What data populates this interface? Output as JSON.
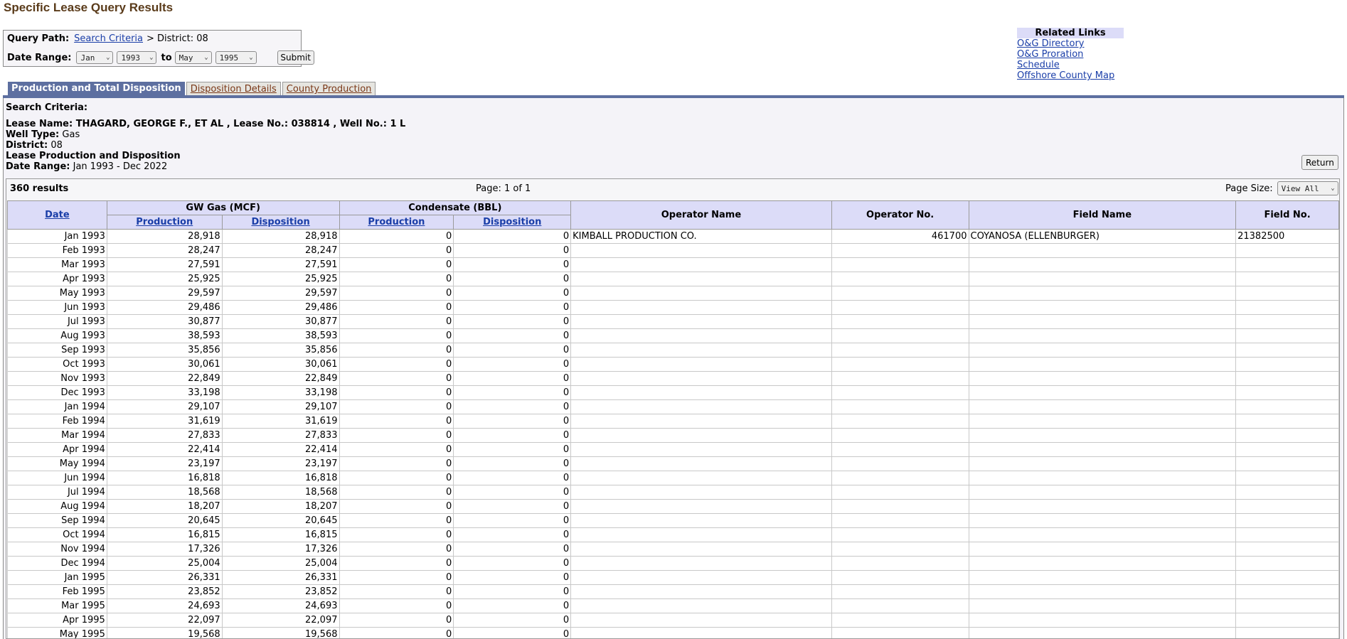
{
  "page_title": "Specific Lease Query Results",
  "query": {
    "path_label": "Query Path:",
    "path_link": "Search Criteria",
    "path_rest": "> District: 08",
    "range_label": "Date Range:",
    "from_month": "Jan",
    "from_year": "1993",
    "to_label": "to",
    "to_month": "May",
    "to_year": "1995",
    "submit_label": "Submit"
  },
  "related_links": {
    "heading": "Related Links",
    "items": [
      "O&G Directory",
      "O&G Proration Schedule",
      "Offshore County Map"
    ]
  },
  "tabs": [
    {
      "label": "Production and Total Disposition",
      "active": true
    },
    {
      "label": "Disposition Details",
      "active": false
    },
    {
      "label": "County Production",
      "active": false
    }
  ],
  "criteria": {
    "heading": "Search Criteria:",
    "lease_line": "Lease Name: THAGARD, GEORGE F., ET AL , Lease No.: 038814 , Well No.: 1 L",
    "well_type_label": "Well Type:",
    "well_type": "Gas",
    "district_label": "District:",
    "district": "08",
    "section_label": "Lease Production and Disposition",
    "range_label": "Date Range:",
    "range": "Jan 1993 - Dec 2022"
  },
  "return_label": "Return",
  "results": {
    "count_text": "360 results",
    "page_text": "Page: 1 of 1",
    "page_size_label": "Page Size:",
    "page_size_value": "View All"
  },
  "table": {
    "headers": {
      "date": "Date",
      "gas_group": "GW Gas (MCF)",
      "cond_group": "Condensate (BBL)",
      "production": "Production",
      "disposition": "Disposition",
      "operator_name": "Operator Name",
      "operator_no": "Operator No.",
      "field_name": "Field Name",
      "field_no": "Field No."
    },
    "rows": [
      [
        "Jan 1993",
        "28,918",
        "28,918",
        "0",
        "0",
        "KIMBALL PRODUCTION CO.",
        "461700",
        "COYANOSA (ELLENBURGER)",
        "21382500"
      ],
      [
        "Feb 1993",
        "28,247",
        "28,247",
        "0",
        "0",
        "",
        "",
        "",
        ""
      ],
      [
        "Mar 1993",
        "27,591",
        "27,591",
        "0",
        "0",
        "",
        "",
        "",
        ""
      ],
      [
        "Apr 1993",
        "25,925",
        "25,925",
        "0",
        "0",
        "",
        "",
        "",
        ""
      ],
      [
        "May 1993",
        "29,597",
        "29,597",
        "0",
        "0",
        "",
        "",
        "",
        ""
      ],
      [
        "Jun 1993",
        "29,486",
        "29,486",
        "0",
        "0",
        "",
        "",
        "",
        ""
      ],
      [
        "Jul 1993",
        "30,877",
        "30,877",
        "0",
        "0",
        "",
        "",
        "",
        ""
      ],
      [
        "Aug 1993",
        "38,593",
        "38,593",
        "0",
        "0",
        "",
        "",
        "",
        ""
      ],
      [
        "Sep 1993",
        "35,856",
        "35,856",
        "0",
        "0",
        "",
        "",
        "",
        ""
      ],
      [
        "Oct 1993",
        "30,061",
        "30,061",
        "0",
        "0",
        "",
        "",
        "",
        ""
      ],
      [
        "Nov 1993",
        "22,849",
        "22,849",
        "0",
        "0",
        "",
        "",
        "",
        ""
      ],
      [
        "Dec 1993",
        "33,198",
        "33,198",
        "0",
        "0",
        "",
        "",
        "",
        ""
      ],
      [
        "Jan 1994",
        "29,107",
        "29,107",
        "0",
        "0",
        "",
        "",
        "",
        ""
      ],
      [
        "Feb 1994",
        "31,619",
        "31,619",
        "0",
        "0",
        "",
        "",
        "",
        ""
      ],
      [
        "Mar 1994",
        "27,833",
        "27,833",
        "0",
        "0",
        "",
        "",
        "",
        ""
      ],
      [
        "Apr 1994",
        "22,414",
        "22,414",
        "0",
        "0",
        "",
        "",
        "",
        ""
      ],
      [
        "May 1994",
        "23,197",
        "23,197",
        "0",
        "0",
        "",
        "",
        "",
        ""
      ],
      [
        "Jun 1994",
        "16,818",
        "16,818",
        "0",
        "0",
        "",
        "",
        "",
        ""
      ],
      [
        "Jul 1994",
        "18,568",
        "18,568",
        "0",
        "0",
        "",
        "",
        "",
        ""
      ],
      [
        "Aug 1994",
        "18,207",
        "18,207",
        "0",
        "0",
        "",
        "",
        "",
        ""
      ],
      [
        "Sep 1994",
        "20,645",
        "20,645",
        "0",
        "0",
        "",
        "",
        "",
        ""
      ],
      [
        "Oct 1994",
        "16,815",
        "16,815",
        "0",
        "0",
        "",
        "",
        "",
        ""
      ],
      [
        "Nov 1994",
        "17,326",
        "17,326",
        "0",
        "0",
        "",
        "",
        "",
        ""
      ],
      [
        "Dec 1994",
        "25,004",
        "25,004",
        "0",
        "0",
        "",
        "",
        "",
        ""
      ],
      [
        "Jan 1995",
        "26,331",
        "26,331",
        "0",
        "0",
        "",
        "",
        "",
        ""
      ],
      [
        "Feb 1995",
        "23,852",
        "23,852",
        "0",
        "0",
        "",
        "",
        "",
        ""
      ],
      [
        "Mar 1995",
        "24,693",
        "24,693",
        "0",
        "0",
        "",
        "",
        "",
        ""
      ],
      [
        "Apr 1995",
        "22,097",
        "22,097",
        "0",
        "0",
        "",
        "",
        "",
        ""
      ],
      [
        "May 1995",
        "19,568",
        "19,568",
        "0",
        "0",
        "",
        "",
        "",
        ""
      ]
    ]
  }
}
